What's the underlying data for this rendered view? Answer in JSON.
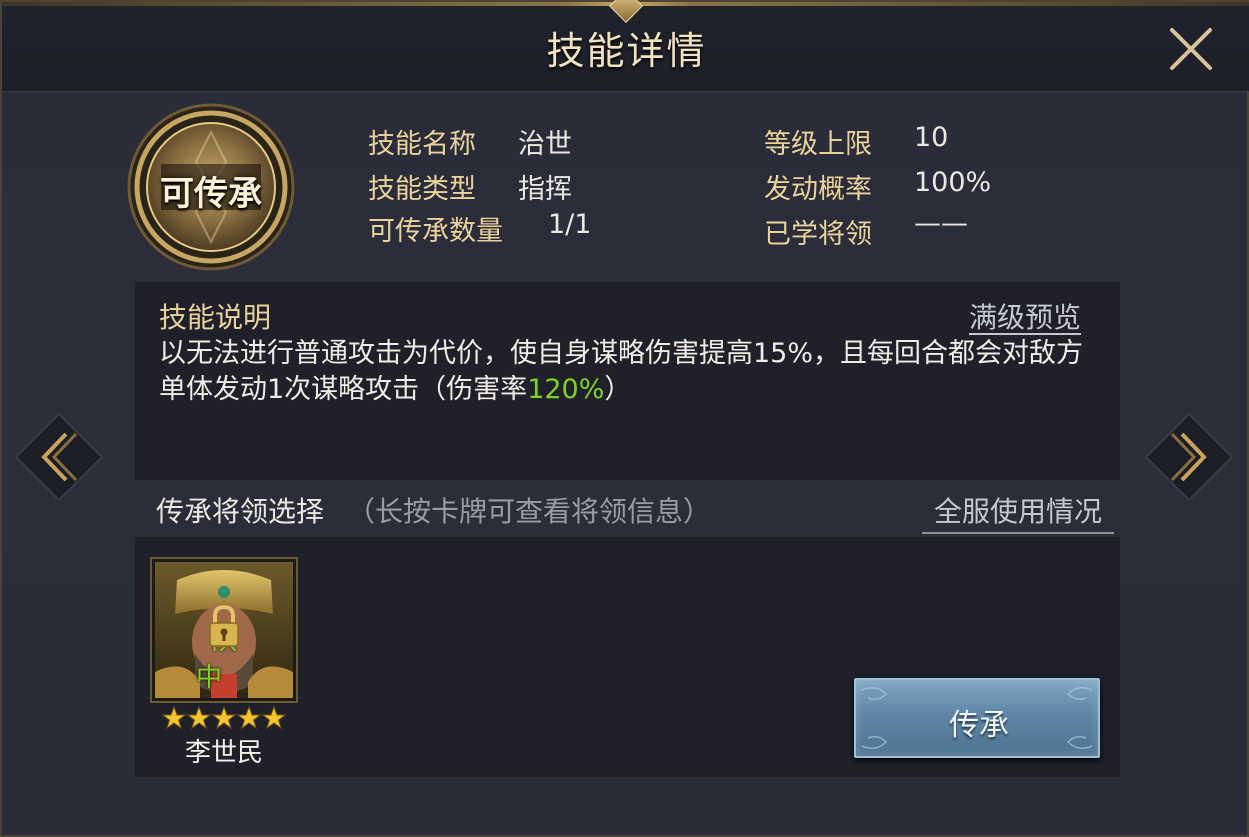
{
  "window": {
    "title": "技能详情"
  },
  "medal": {
    "label": "可传承"
  },
  "info": {
    "skill_name_label": "技能名称",
    "skill_name_value": "治世",
    "skill_type_label": "技能类型",
    "skill_type_value": "指挥",
    "inherit_count_label": "可传承数量",
    "inherit_count_value": "1/1",
    "level_cap_label": "等级上限",
    "level_cap_value": "10",
    "trigger_rate_label": "发动概率",
    "trigger_rate_value": "100%",
    "learned_label": "已学将领",
    "learned_value": "——"
  },
  "description": {
    "title": "技能说明",
    "full_level_preview": "满级预览",
    "text_part1": "以无法进行普通攻击为代价，使自身谋略伤害提高15%，且每回合都会对敌方单体发动1次谋略攻击（伤害率",
    "text_highlight": "120%",
    "text_part2": "）"
  },
  "inherit": {
    "title": "传承将领选择",
    "hint": "（长按卡牌可查看将领信息）",
    "server_usage": "全服使用情况",
    "button_label": "传承"
  },
  "hero": {
    "name": "李世民",
    "team_tag": "队中",
    "stars": 5,
    "locked": true
  },
  "colors": {
    "gold_label": "#e9d39b",
    "highlight_green": "#7ed321",
    "button_blue": "#5f86a6"
  }
}
